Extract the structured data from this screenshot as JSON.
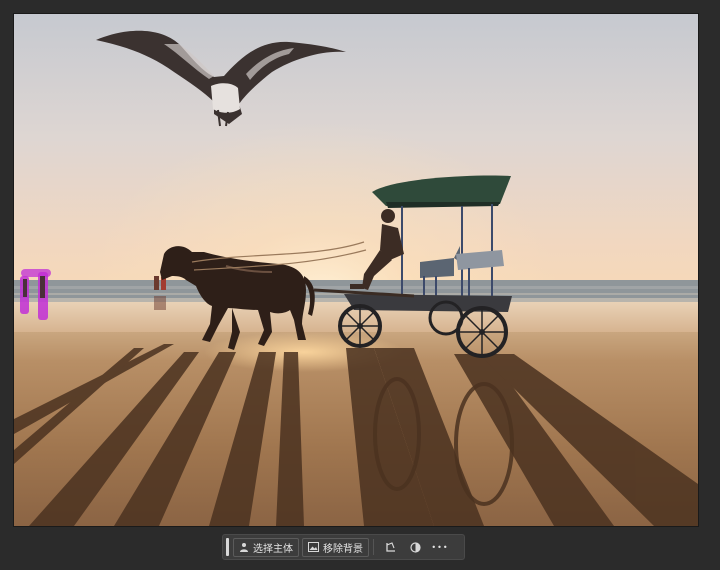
{
  "taskbar": {
    "select_subject_label": "选择主体",
    "remove_background_label": "移除背景",
    "more_label": "•••",
    "icons": {
      "select_subject": "person-icon",
      "remove_background": "image-icon",
      "transform": "crop-transform-icon",
      "adjustment": "half-circle-adjustment-icon",
      "more": "more-options-icon"
    }
  },
  "colors": {
    "workspace_bg": "#2b2b2b",
    "taskbar_bg": "#3c3c3c",
    "selection_highlight": "#c12fd6"
  }
}
